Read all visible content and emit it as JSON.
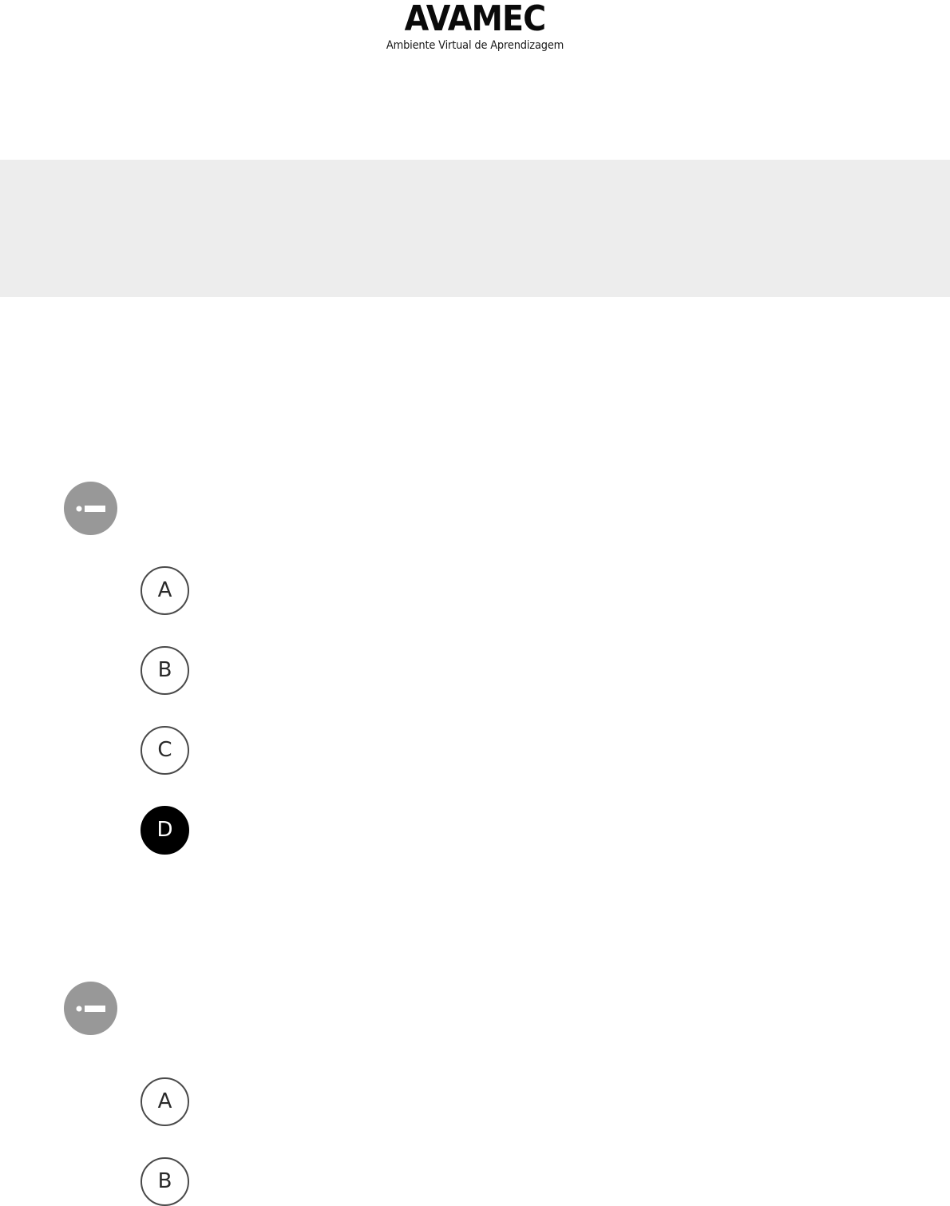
{
  "header": {
    "logo_title": "AVAMEC",
    "logo_subtitle": "Ambiente Virtual de Aprendizagem"
  },
  "questions": [
    {
      "icon": "question-dash-icon",
      "options": [
        {
          "letter": "A",
          "selected": false
        },
        {
          "letter": "B",
          "selected": false
        },
        {
          "letter": "C",
          "selected": false
        },
        {
          "letter": "D",
          "selected": true
        }
      ]
    },
    {
      "icon": "question-dash-icon",
      "options": [
        {
          "letter": "A",
          "selected": false
        },
        {
          "letter": "B",
          "selected": false
        }
      ]
    }
  ],
  "colors": {
    "banner_background": "#ededed",
    "icon_background": "#989898",
    "selected_option": "#000000",
    "option_border": "#4a4a4a"
  }
}
